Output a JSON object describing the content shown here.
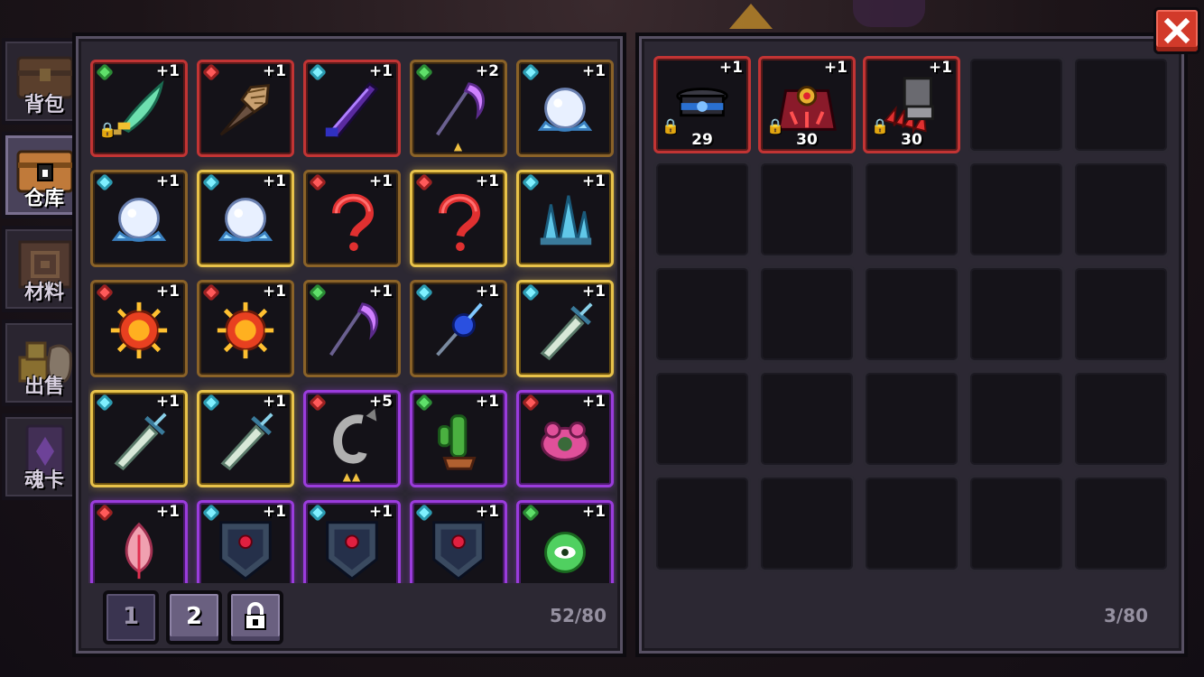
{
  "side_tabs": [
    {
      "label": "背包",
      "active": false
    },
    {
      "label": "仓库",
      "active": true
    },
    {
      "label": "材料",
      "active": false
    },
    {
      "label": "出售",
      "active": false
    },
    {
      "label": "魂卡",
      "active": false
    }
  ],
  "warehouse": {
    "count_text": "52/80",
    "pages": [
      "1",
      "2"
    ],
    "active_page": "1",
    "items": [
      {
        "name": "green-scimitar",
        "rarity": "r-red-lite",
        "frame": "r-red",
        "gem": "green",
        "plus": "+1",
        "locked": true,
        "stars": ""
      },
      {
        "name": "drill-lance",
        "frame": "r-red",
        "gem": "red",
        "plus": "+1",
        "locked": false,
        "stars": ""
      },
      {
        "name": "void-blade",
        "frame": "r-red",
        "gem": "cyan",
        "plus": "+1",
        "locked": false,
        "stars": ""
      },
      {
        "name": "scythe",
        "frame": "r-orange",
        "gem": "green",
        "plus": "+2",
        "locked": false,
        "stars": "▲"
      },
      {
        "name": "frost-orb",
        "frame": "r-orange",
        "gem": "cyan",
        "plus": "+1",
        "locked": false,
        "stars": ""
      },
      {
        "name": "frost-orb",
        "frame": "r-orange",
        "gem": "cyan",
        "plus": "+1",
        "locked": false,
        "stars": ""
      },
      {
        "name": "frost-orb",
        "frame": "r-gold",
        "gem": "cyan",
        "plus": "+1",
        "locked": false,
        "stars": ""
      },
      {
        "name": "question-hook",
        "frame": "r-orange",
        "gem": "red",
        "plus": "+1",
        "locked": false,
        "stars": ""
      },
      {
        "name": "question-hook",
        "frame": "r-gold",
        "gem": "red",
        "plus": "+1",
        "locked": false,
        "stars": ""
      },
      {
        "name": "ice-crystal",
        "frame": "r-gold",
        "gem": "cyan",
        "plus": "+1",
        "locked": false,
        "stars": ""
      },
      {
        "name": "sun-gear",
        "frame": "r-orange",
        "gem": "red",
        "plus": "+1",
        "locked": false,
        "stars": ""
      },
      {
        "name": "sun-gear",
        "frame": "r-orange",
        "gem": "red",
        "plus": "+1",
        "locked": false,
        "stars": ""
      },
      {
        "name": "scythe",
        "frame": "r-orange",
        "gem": "green",
        "plus": "+1",
        "locked": false,
        "stars": ""
      },
      {
        "name": "blue-staff",
        "frame": "r-orange",
        "gem": "cyan",
        "plus": "+1",
        "locked": false,
        "stars": ""
      },
      {
        "name": "short-sword",
        "frame": "r-gold",
        "gem": "cyan",
        "plus": "+1",
        "locked": false,
        "stars": ""
      },
      {
        "name": "short-sword",
        "frame": "r-gold",
        "gem": "cyan",
        "plus": "+1",
        "locked": false,
        "stars": ""
      },
      {
        "name": "short-sword",
        "frame": "r-gold",
        "gem": "cyan",
        "plus": "+1",
        "locked": false,
        "stars": ""
      },
      {
        "name": "steel-hook",
        "frame": "r-purple",
        "gem": "red",
        "plus": "+5",
        "locked": false,
        "stars": "▲▲"
      },
      {
        "name": "cactus",
        "frame": "r-purple",
        "gem": "green",
        "plus": "+1",
        "locked": false,
        "stars": ""
      },
      {
        "name": "pink-flower",
        "frame": "r-purple",
        "gem": "red",
        "plus": "+1",
        "locked": false,
        "stars": ""
      },
      {
        "name": "pink-feather",
        "frame": "r-purple",
        "gem": "red",
        "plus": "+1",
        "locked": false,
        "stars": ""
      },
      {
        "name": "ruby-shield",
        "frame": "r-purple",
        "gem": "cyan",
        "plus": "+1",
        "locked": false,
        "stars": ""
      },
      {
        "name": "ruby-shield",
        "frame": "r-purple",
        "gem": "cyan",
        "plus": "+1",
        "locked": false,
        "stars": ""
      },
      {
        "name": "ruby-shield",
        "frame": "r-purple",
        "gem": "cyan",
        "plus": "+1",
        "locked": false,
        "stars": ""
      },
      {
        "name": "green-eye",
        "frame": "r-purple",
        "gem": "green",
        "plus": "+1",
        "locked": false,
        "stars": ""
      }
    ]
  },
  "backpack": {
    "count_text": "3/80",
    "items": [
      {
        "name": "blue-cap",
        "plus": "+1",
        "level": "29",
        "locked": true
      },
      {
        "name": "crimson-cloak",
        "plus": "+1",
        "level": "30",
        "locked": true
      },
      {
        "name": "spiked-gauntlet",
        "plus": "+1",
        "level": "30",
        "locked": true
      }
    ]
  },
  "close_label": "✕"
}
